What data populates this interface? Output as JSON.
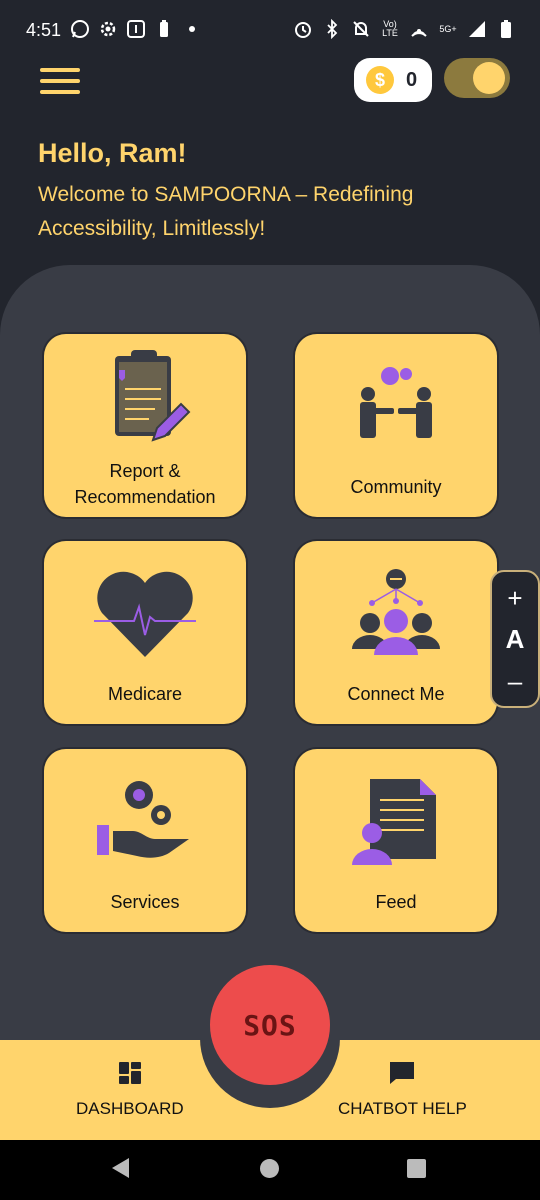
{
  "status_bar": {
    "time": "4:51",
    "network_label": "5G+",
    "volte_label": "Vo) LTE"
  },
  "header": {
    "coins": "0",
    "theme_toggle_on": true,
    "greeting": "Hello, Ram!",
    "welcome": "Welcome to SAMPOORNA – Redefining Accessibility, Limitlessly!"
  },
  "tiles": [
    {
      "label": "Report & Recommendation",
      "icon": "clipboard-icon"
    },
    {
      "label": "Community",
      "icon": "community-icon"
    },
    {
      "label": "Medicare",
      "icon": "heart-icon"
    },
    {
      "label": "Connect Me",
      "icon": "connect-icon"
    },
    {
      "label": "Services",
      "icon": "services-icon"
    },
    {
      "label": "Feed",
      "icon": "feed-icon"
    }
  ],
  "font_size_widget": {
    "increase": "+",
    "letter": "A",
    "decrease": "–"
  },
  "sos": {
    "label": "SOS"
  },
  "bottom_nav": {
    "dashboard": "DASHBOARD",
    "chatbot": "CHATBOT HELP"
  },
  "colors": {
    "accent": "#ffd46c",
    "background": "#22252d",
    "panel": "#393c45",
    "sos": "#ed4c4c",
    "purple": "#9b5de5"
  }
}
